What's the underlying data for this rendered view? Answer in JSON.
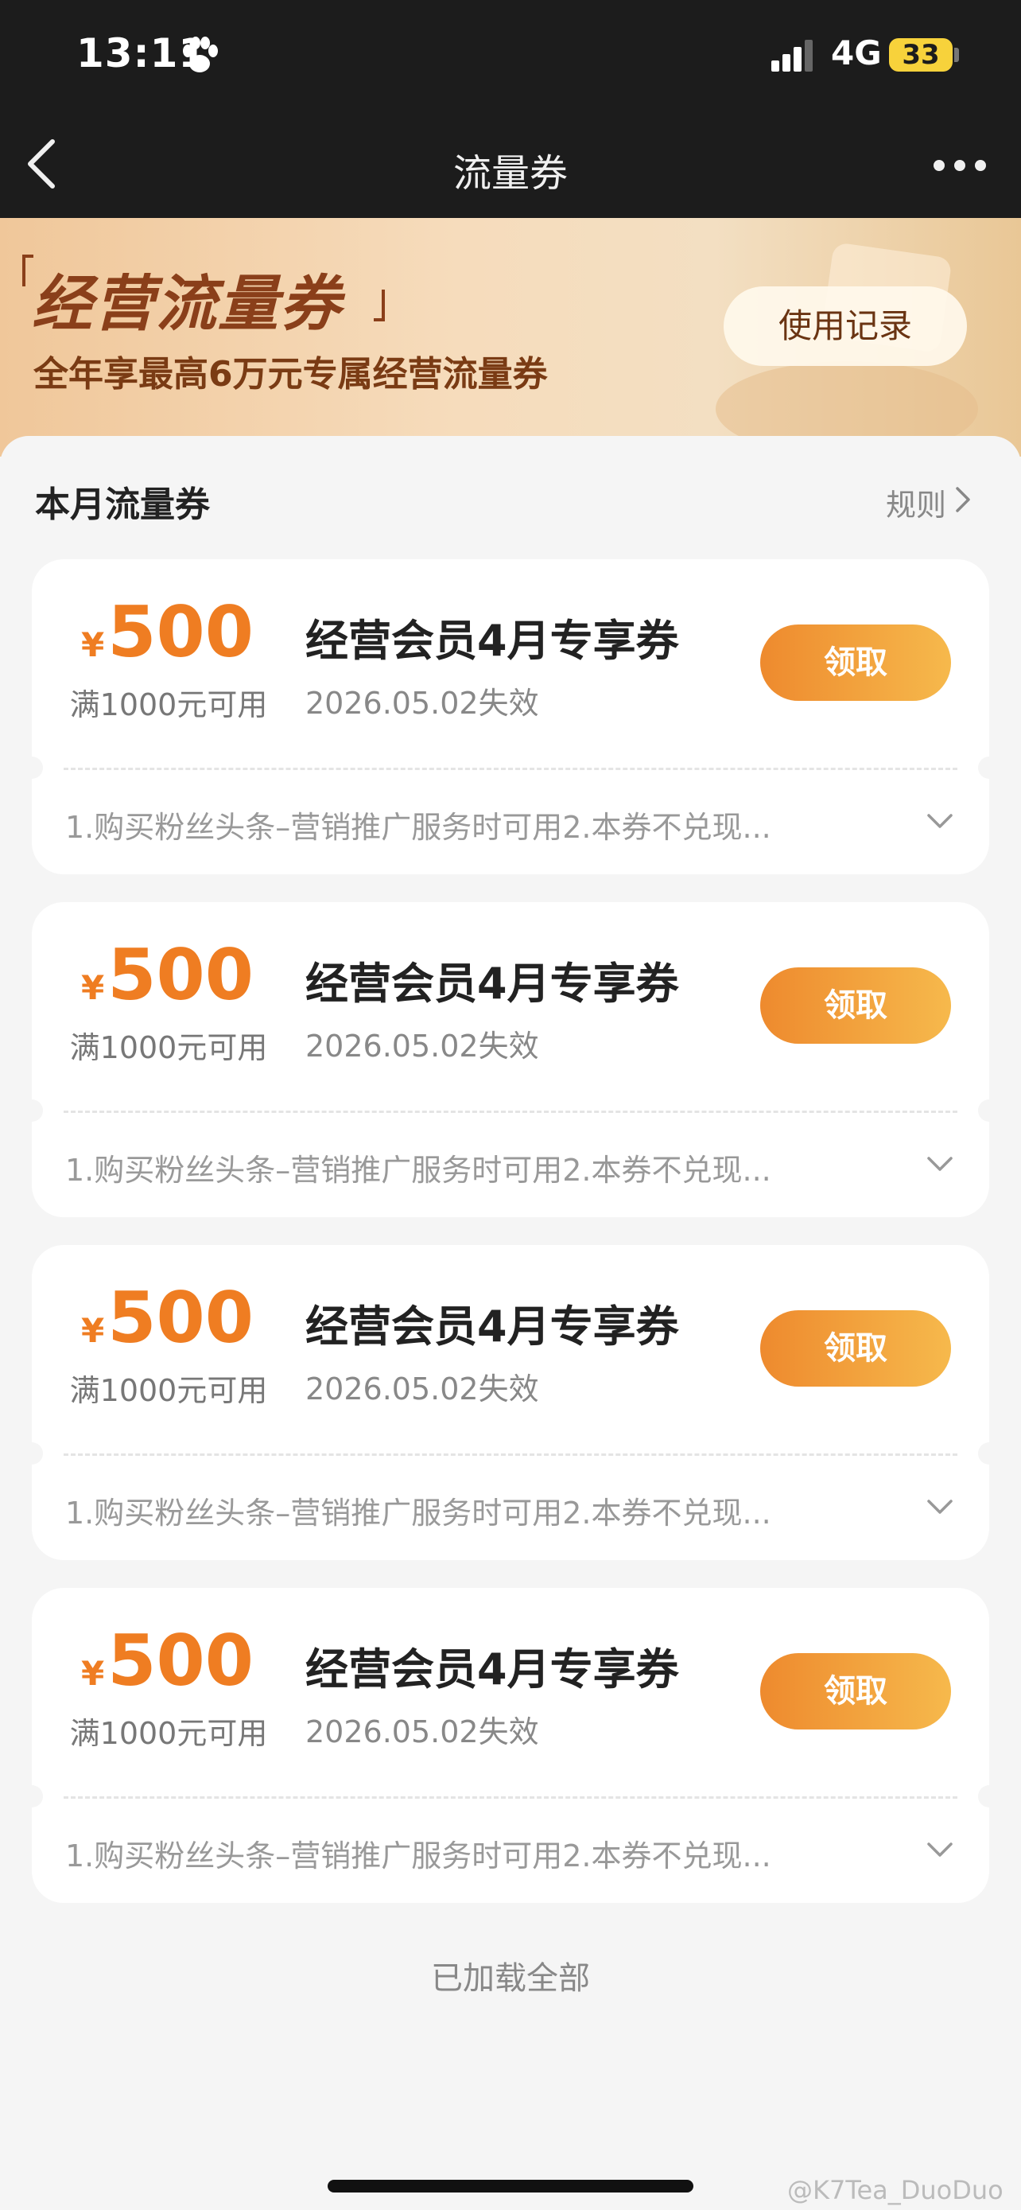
{
  "status_bar": {
    "time": "13:11",
    "network": "4G",
    "battery": "33"
  },
  "nav": {
    "title": "流量券"
  },
  "banner": {
    "title": "经营流量券",
    "subtitle": "全年享最高6万元专属经营流量券",
    "record_button": "使用记录"
  },
  "section": {
    "title": "本月流量券",
    "rules_label": "规则"
  },
  "coupons": [
    {
      "currency": "¥",
      "amount": "500",
      "condition": "满1000元可用",
      "name": "经营会员4月专享券",
      "expiry": "2026.05.02失效",
      "claim_label": "领取",
      "description": "1.购买粉丝头条–营销推广服务时可用2.本券不兑现..."
    },
    {
      "currency": "¥",
      "amount": "500",
      "condition": "满1000元可用",
      "name": "经营会员4月专享券",
      "expiry": "2026.05.02失效",
      "claim_label": "领取",
      "description": "1.购买粉丝头条–营销推广服务时可用2.本券不兑现..."
    },
    {
      "currency": "¥",
      "amount": "500",
      "condition": "满1000元可用",
      "name": "经营会员4月专享券",
      "expiry": "2026.05.02失效",
      "claim_label": "领取",
      "description": "1.购买粉丝头条–营销推广服务时可用2.本券不兑现..."
    },
    {
      "currency": "¥",
      "amount": "500",
      "condition": "满1000元可用",
      "name": "经营会员4月专享券",
      "expiry": "2026.05.02失效",
      "claim_label": "领取",
      "description": "1.购买粉丝头条–营销推广服务时可用2.本券不兑现..."
    }
  ],
  "footer": {
    "loaded_all": "已加载全部",
    "watermark": "@K7Tea_DuoDuo"
  },
  "colors": {
    "accent_orange": "#ef7d22",
    "top_bar": "#1c1c1c",
    "banner_text": "#8a3f1a"
  },
  "icons": [
    "paw-icon",
    "signal-icon",
    "battery-icon",
    "back-icon",
    "more-icon",
    "chevron-right-icon",
    "chevron-down-icon"
  ]
}
